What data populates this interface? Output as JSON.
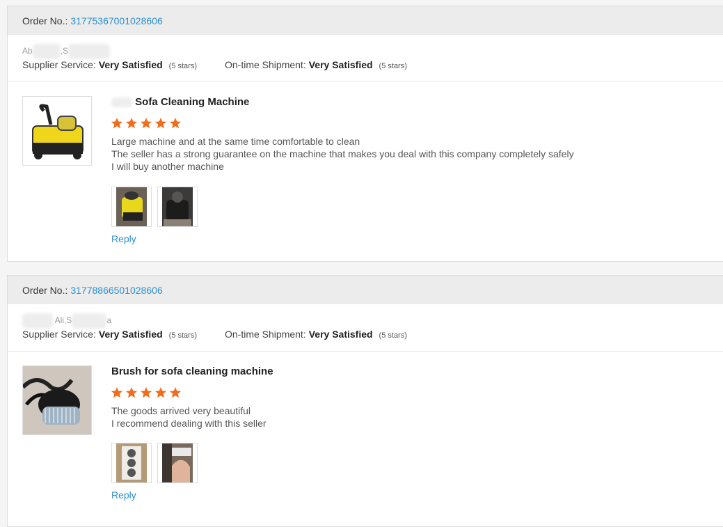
{
  "orders": [
    {
      "order_label": "Order No.:",
      "order_number": "31775367001028606",
      "buyer": {
        "prefix": "Ab",
        "separator": ",S"
      },
      "supplier_service": {
        "label": "Supplier Service:",
        "value": "Very Satisfied",
        "stars": "(5 stars)"
      },
      "shipment": {
        "label": "On-time Shipment:",
        "value": "Very Satisfied",
        "stars": "(5 stars)"
      },
      "product_title": "Sofa Cleaning Machine",
      "rating": 5,
      "review_lines": [
        "Large machine and at the same time comfortable to clean",
        "The seller has a strong guarantee on the machine that makes you deal with this company completely safely",
        "I will buy another machine"
      ],
      "reply_label": "Reply"
    },
    {
      "order_label": "Order No.:",
      "order_number": "31778866501028606",
      "buyer": {
        "prefix": "Ali,S",
        "suffix": "a"
      },
      "supplier_service": {
        "label": "Supplier Service:",
        "value": "Very Satisfied",
        "stars": "(5 stars)"
      },
      "shipment": {
        "label": "On-time Shipment:",
        "value": "Very Satisfied",
        "stars": "(5 stars)"
      },
      "product_title": "Brush for sofa cleaning machine",
      "rating": 5,
      "review_lines": [
        "The goods arrived very beautiful",
        "I recommend dealing with this seller"
      ],
      "reply_label": "Reply"
    }
  ],
  "colors": {
    "link": "#2b8fd5",
    "star": "#f26c1d",
    "header_bg": "#ececec"
  },
  "icons": [
    "star-icon",
    "product-image",
    "review-photo"
  ]
}
